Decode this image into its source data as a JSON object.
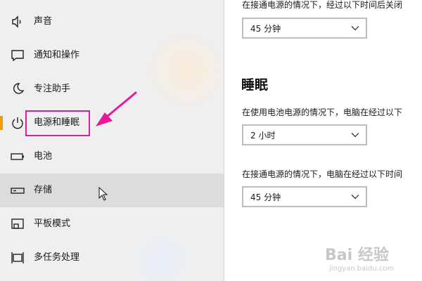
{
  "sidebar": {
    "items": [
      {
        "label": "声音",
        "icon": "speaker-icon"
      },
      {
        "label": "通知和操作",
        "icon": "notification-icon"
      },
      {
        "label": "专注助手",
        "icon": "moon-icon"
      },
      {
        "label": "电源和睡眠",
        "icon": "power-icon",
        "active": true
      },
      {
        "label": "电池",
        "icon": "battery-icon"
      },
      {
        "label": "存储",
        "icon": "storage-icon",
        "hovered": true
      },
      {
        "label": "平板模式",
        "icon": "tablet-icon"
      },
      {
        "label": "多任务处理",
        "icon": "multitask-icon"
      }
    ]
  },
  "main": {
    "screen_plugged_desc": "在接通电源的情况下，经过以下时间后关闭",
    "screen_plugged_value": "45 分钟",
    "sleep_title": "睡眠",
    "sleep_battery_desc": "在使用电池电源的情况下，电脑在经过以下",
    "sleep_battery_value": "2 小时",
    "sleep_plugged_desc": "在接通电源的情况下，电脑在经过以下时间",
    "sleep_plugged_value": "45 分钟"
  },
  "watermark": {
    "logo": "Bai 经验",
    "url": "jingyan.baidu.com"
  },
  "colors": {
    "accent": "#e8a000",
    "annotation": "#e8189a",
    "sidebar_bg": "#efefef",
    "hover_bg": "#dcdcdc"
  }
}
